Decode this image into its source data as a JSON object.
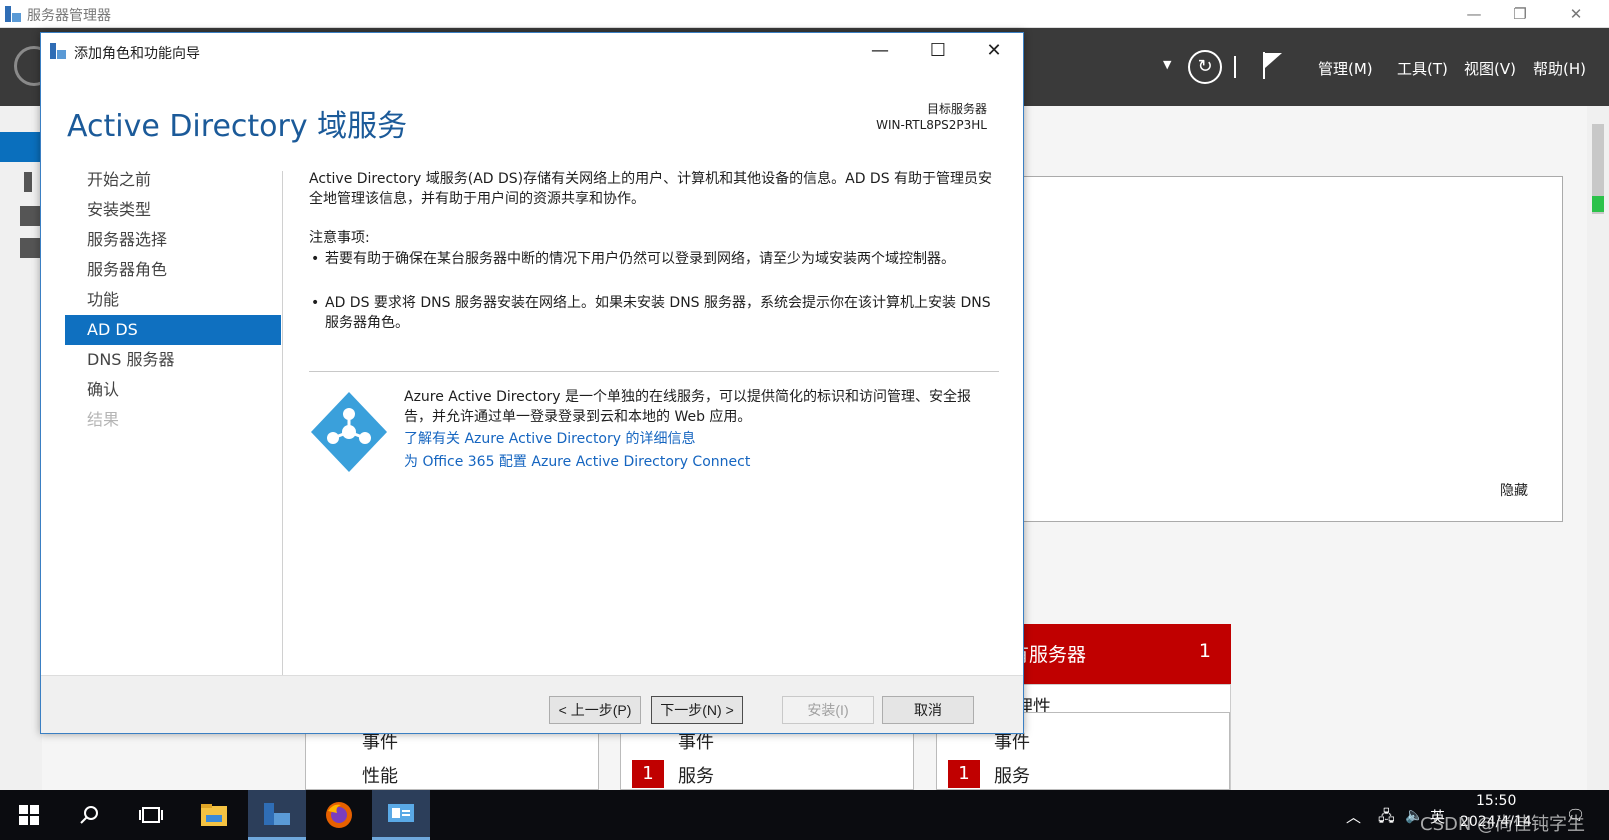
{
  "server_manager": {
    "title": "服务器管理器",
    "menus": [
      "管理(M)",
      "工具(T)",
      "视图(V)",
      "帮助(H)"
    ],
    "hide_label": "隐藏",
    "red_tile": {
      "label": "有服务器",
      "count": "1"
    },
    "white_tile_label": "理性",
    "tiles": [
      {
        "row1": "事件",
        "row2": "性能"
      },
      {
        "row1": "事件",
        "badge": "1",
        "row2": "服务"
      },
      {
        "row1": "事件",
        "badge": "1",
        "row2": "服务"
      }
    ]
  },
  "wizard": {
    "title": "添加角色和功能向导",
    "heading": "Active Directory 域服务",
    "target_label": "目标服务器",
    "target_value": "WIN-RTL8PS2P3HL",
    "steps": [
      {
        "label": "开始之前",
        "state": "normal"
      },
      {
        "label": "安装类型",
        "state": "normal"
      },
      {
        "label": "服务器选择",
        "state": "normal"
      },
      {
        "label": "服务器角色",
        "state": "normal"
      },
      {
        "label": "功能",
        "state": "normal"
      },
      {
        "label": "AD DS",
        "state": "active"
      },
      {
        "label": "DNS 服务器",
        "state": "normal"
      },
      {
        "label": "确认",
        "state": "normal"
      },
      {
        "label": "结果",
        "state": "disabled"
      }
    ],
    "description": "Active Directory 域服务(AD DS)存储有关网络上的用户、计算机和其他设备的信息。AD DS 有助于管理员安全地管理该信息，并有助于用户间的资源共享和协作。",
    "notes_heading": "注意事项:",
    "notes": [
      "若要有助于确保在某台服务器中断的情况下用户仍然可以登录到网络，请至少为域安装两个域控制器。",
      "AD DS 要求将 DNS 服务器安装在网络上。如果未安装 DNS 服务器，系统会提示你在该计算机上安装 DNS 服务器角色。"
    ],
    "azure_text": "Azure Active Directory 是一个单独的在线服务，可以提供简化的标识和访问管理、安全报告，并允许通过单一登录登录到云和本地的 Web 应用。",
    "links": [
      "了解有关 Azure Active Directory 的详细信息",
      "为 Office 365 配置 Azure Active Directory Connect"
    ],
    "buttons": {
      "prev": "< 上一步(P)",
      "next": "下一步(N) >",
      "install": "安装(I)",
      "cancel": "取消"
    }
  },
  "taskbar": {
    "time": "15:50",
    "date": "2024/4/14",
    "ime": "英"
  },
  "watermark": "CSDN @尚佳钝字生",
  "colors": {
    "accent": "#0f70c0",
    "heading": "#1b5a99",
    "link": "#1565c0",
    "alert": "#c00000"
  }
}
